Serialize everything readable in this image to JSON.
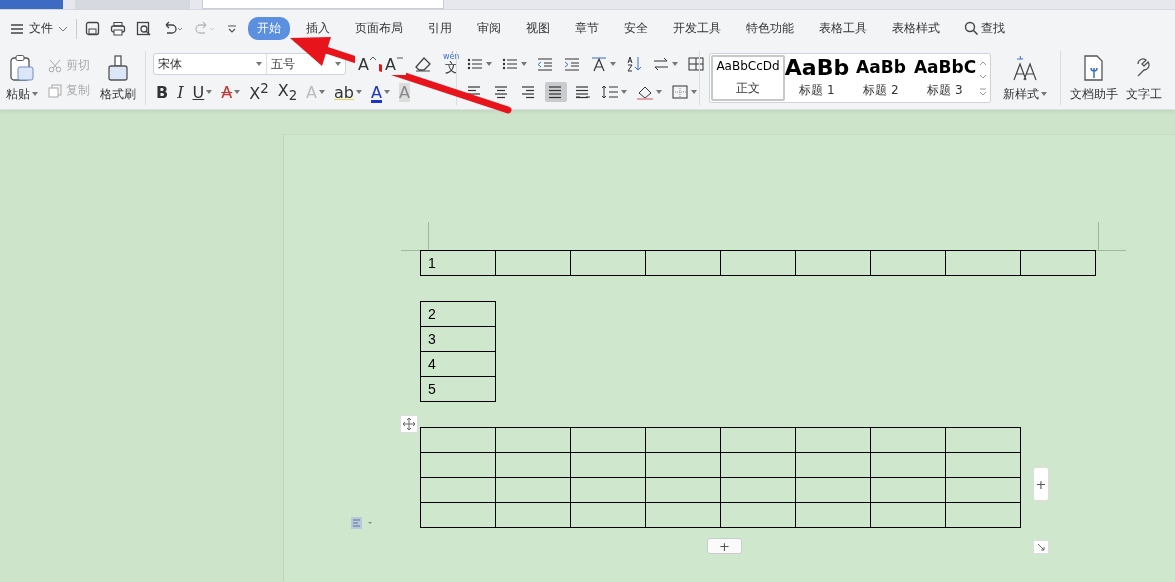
{
  "menu": {
    "file_label": "文件",
    "tabs": [
      {
        "label": "开始",
        "selected": true
      },
      {
        "label": "插入",
        "selected": false
      },
      {
        "label": "页面布局",
        "selected": false
      },
      {
        "label": "引用",
        "selected": false
      },
      {
        "label": "审阅",
        "selected": false
      },
      {
        "label": "视图",
        "selected": false
      },
      {
        "label": "章节",
        "selected": false
      },
      {
        "label": "安全",
        "selected": false
      },
      {
        "label": "开发工具",
        "selected": false
      },
      {
        "label": "特色功能",
        "selected": false
      },
      {
        "label": "表格工具",
        "selected": false
      },
      {
        "label": "表格样式",
        "selected": false
      }
    ],
    "search_label": "查找"
  },
  "clipboard": {
    "paste": "粘贴",
    "cut": {
      "label": "剪切",
      "disabled": true
    },
    "copy": {
      "label": "复制",
      "disabled": true
    },
    "painter": "格式刷"
  },
  "font": {
    "family": "宋体",
    "size": "五号",
    "phonetic": {
      "top": "wén",
      "char": "文"
    },
    "row1": [
      {
        "kind": "grow",
        "glyph": "A"
      },
      {
        "kind": "shrink",
        "glyph": "A"
      }
    ],
    "row2": [
      {
        "kind": "bold",
        "glyph": "B",
        "dropdown": false
      },
      {
        "kind": "italic",
        "glyph": "I",
        "dropdown": false
      },
      {
        "kind": "underline",
        "glyph": "U",
        "dropdown": true
      },
      {
        "kind": "strike",
        "glyph": "A",
        "dropdown": true
      },
      {
        "kind": "plain",
        "glyph": "X$^{2}$",
        "dropdown": false
      },
      {
        "kind": "plain",
        "glyph": "X$_{2}$",
        "dropdown": false
      },
      {
        "kind": "effect",
        "glyph": "A",
        "dropdown": true
      },
      {
        "kind": "highlight",
        "glyph": "ab",
        "dropdown": true
      },
      {
        "kind": "color",
        "glyph": "A",
        "dropdown": true
      },
      {
        "kind": "shade",
        "glyph": "A",
        "dropdown": false
      }
    ]
  },
  "paragraph": {
    "row1": [
      {
        "kind": "bullets",
        "dropdown": true,
        "selected": false
      },
      {
        "kind": "numbering",
        "dropdown": true,
        "selected": false
      },
      {
        "kind": "outdent",
        "dropdown": false,
        "selected": false
      },
      {
        "kind": "indent",
        "dropdown": false,
        "selected": false
      },
      {
        "kind": "direction",
        "dropdown": true,
        "selected": false
      },
      {
        "kind": "sort",
        "dropdown": false,
        "selected": false
      },
      {
        "kind": "convert",
        "dropdown": true,
        "selected": false
      },
      {
        "kind": "grid",
        "dropdown": false,
        "selected": false
      }
    ],
    "row2": [
      {
        "kind": "align-left",
        "dropdown": false,
        "selected": false
      },
      {
        "kind": "align-center",
        "dropdown": false,
        "selected": false
      },
      {
        "kind": "align-right",
        "dropdown": false,
        "selected": false
      },
      {
        "kind": "justify",
        "dropdown": false,
        "selected": true
      },
      {
        "kind": "distribute",
        "dropdown": false,
        "selected": false
      },
      {
        "kind": "spacing",
        "dropdown": true,
        "selected": false
      },
      {
        "kind": "fill",
        "dropdown": true,
        "selected": false
      },
      {
        "kind": "borders",
        "dropdown": true,
        "selected": false
      }
    ]
  },
  "styles": [
    {
      "preview": "AaBbCcDd",
      "label": "正文",
      "kind": "body",
      "selected": true
    },
    {
      "preview": "AaBb",
      "label": "标题 1",
      "kind": "h1",
      "selected": false
    },
    {
      "preview": "AaBb",
      "label": "标题 2",
      "kind": "h2",
      "selected": false
    },
    {
      "preview": "AaBbC",
      "label": "标题 3",
      "kind": "h3",
      "selected": false
    }
  ],
  "new_style": "新样式",
  "tools": [
    "文档助手",
    "文字工"
  ],
  "tables": [
    {
      "rows": [
        {
          "cells": [
            {
              "kind": "text",
              "text": "1"
            },
            {
              "kind": "blank"
            },
            {
              "kind": "blank"
            },
            {
              "kind": "blank"
            },
            {
              "kind": "blank"
            },
            {
              "kind": "blank"
            },
            {
              "kind": "blank"
            },
            {
              "kind": "blank"
            },
            {
              "kind": "blank"
            }
          ]
        }
      ]
    },
    {
      "rows": [
        {
          "cells": [
            {
              "kind": "text",
              "text": "2"
            }
          ]
        },
        {
          "cells": [
            {
              "kind": "text",
              "text": "3"
            }
          ]
        },
        {
          "cells": [
            {
              "kind": "text",
              "text": "4"
            }
          ]
        },
        {
          "cells": [
            {
              "kind": "text",
              "text": "5"
            }
          ]
        }
      ]
    },
    {
      "rows": [
        {
          "cells": [
            {
              "kind": "blank"
            },
            {
              "kind": "blank"
            },
            {
              "kind": "blank"
            },
            {
              "kind": "blank"
            },
            {
              "kind": "blank"
            },
            {
              "kind": "blank"
            },
            {
              "kind": "blank"
            },
            {
              "kind": "blank"
            }
          ]
        },
        {
          "cells": [
            {
              "kind": "blank"
            },
            {
              "kind": "blank"
            },
            {
              "kind": "blank"
            },
            {
              "kind": "blank"
            },
            {
              "kind": "blank"
            },
            {
              "kind": "blank"
            },
            {
              "kind": "blank"
            },
            {
              "kind": "blank"
            }
          ]
        },
        {
          "cells": [
            {
              "kind": "blank"
            },
            {
              "kind": "blank"
            },
            {
              "kind": "blank"
            },
            {
              "kind": "blank"
            },
            {
              "kind": "blank"
            },
            {
              "kind": "blank"
            },
            {
              "kind": "blank"
            },
            {
              "kind": "blank"
            }
          ]
        },
        {
          "cells": [
            {
              "kind": "blank"
            },
            {
              "kind": "blank"
            },
            {
              "kind": "blank"
            },
            {
              "kind": "blank"
            },
            {
              "kind": "blank"
            },
            {
              "kind": "blank"
            },
            {
              "kind": "blank"
            },
            {
              "kind": "blank"
            }
          ]
        }
      ]
    }
  ],
  "table_controls": {
    "add_column": "+",
    "add_row": "+"
  }
}
